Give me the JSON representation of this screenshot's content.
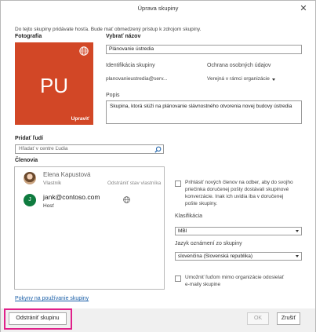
{
  "dialog": {
    "title": "Úprava skupiny",
    "close_glyph": "✕"
  },
  "intro": "Do tejto skupiny pridávate hosťa. Bude mať obmedzený prístup k zdrojom skupiny.",
  "photo": {
    "label": "Fotografia",
    "initials": "PU",
    "change_label": "Upraviť",
    "tile_color": "#d24726",
    "badge_icon": "globe-icon"
  },
  "name": {
    "label": "Vybrať názov",
    "value": "Plánovanie ústredia"
  },
  "group_id": {
    "label": "Identifikácia skupiny",
    "value": "planovanieustredia@serv..."
  },
  "privacy": {
    "label": "Ochrana osobných údajov",
    "value": "Verejná v rámci organizácie"
  },
  "description": {
    "label": "Popis",
    "value": "Skupina, ktorá slúži na plánovanie slávnostného otvorenia novej budovy ústredia"
  },
  "add_people": {
    "label": "Pridať ľudí",
    "placeholder": "Hľadať v centre Ľudia",
    "icon": "search-icon"
  },
  "members": {
    "label": "Členovia",
    "items": [
      {
        "name": "Elena Kapustová",
        "role": "Vlastník",
        "action": "Odstrániť stav vlastníka",
        "avatar": "photo"
      },
      {
        "name": "jank@contoso.com",
        "role": "Hosť",
        "initial": "J",
        "avatar": "initial",
        "icon": "globe-icon"
      }
    ]
  },
  "subscribe": {
    "text_line1": "Prihlásiť nových členov na odber, aby do svojho",
    "text_line2": "priečinka doručenej pošty dostávali skupinové",
    "text_line3": "konverzácie. Inak ich uvidia iba v doručenej",
    "text_line4": "pošte skupiny.",
    "checked": false
  },
  "classification": {
    "label": "Klasifikácia",
    "value": "MBI"
  },
  "language": {
    "label": "Jazyk oznámení zo skupiny",
    "value": "slovenčina (Slovenská republika)"
  },
  "external": {
    "text_line1": "Umožniť ľuďom mimo organizácie odosielať",
    "text_line2": "e-maily skupine",
    "checked": false
  },
  "guidelines_link": "Pokyny na používanie skupiny",
  "footer": {
    "delete_label": "Odstrániť skupinu",
    "ok_label": "OK",
    "cancel_label": "Zrušiť",
    "highlight_color": "#e0218a"
  }
}
